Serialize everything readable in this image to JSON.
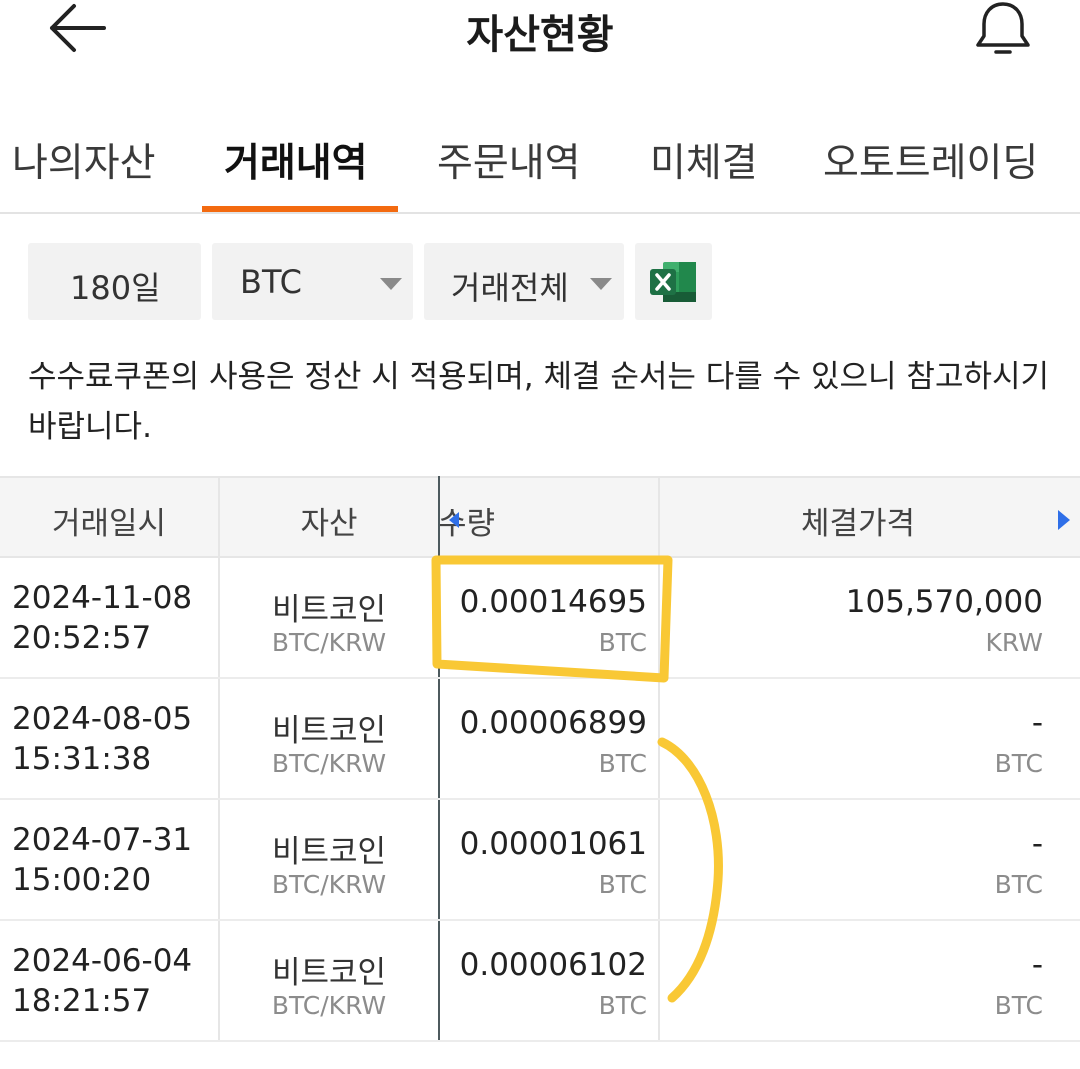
{
  "header": {
    "title": "자산현황",
    "back_icon": "arrow-left-icon",
    "bell_icon": "bell-icon"
  },
  "tabs": [
    {
      "label": "나의자산",
      "active": false
    },
    {
      "label": "거래내역",
      "active": true
    },
    {
      "label": "주문내역",
      "active": false
    },
    {
      "label": "미체결",
      "active": false
    },
    {
      "label": "오토트레이딩",
      "active": false
    }
  ],
  "filters": {
    "period": "180일",
    "asset": "BTC",
    "trade_type": "거래전체",
    "excel_icon": "excel-icon"
  },
  "notice": "수수료쿠폰의 사용은 정산 시 적용되며, 체결 순서는 다를 수 있으니 참고하시기 바랍니다.",
  "table": {
    "headers": [
      "거래일시",
      "자산",
      "수량",
      "체결가격"
    ],
    "rows": [
      {
        "date": "2024-11-08",
        "time": "20:52:57",
        "asset": "비트코인",
        "pair": "BTC/KRW",
        "qty": "0.00014695",
        "qty_unit": "BTC",
        "price": "105,570,000",
        "price_unit": "KRW"
      },
      {
        "date": "2024-08-05",
        "time": "15:31:38",
        "asset": "비트코인",
        "pair": "BTC/KRW",
        "qty": "0.00006899",
        "qty_unit": "BTC",
        "price": "-",
        "price_unit": "BTC"
      },
      {
        "date": "2024-07-31",
        "time": "15:00:20",
        "asset": "비트코인",
        "pair": "BTC/KRW",
        "qty": "0.00001061",
        "qty_unit": "BTC",
        "price": "-",
        "price_unit": "BTC"
      },
      {
        "date": "2024-06-04",
        "time": "18:21:57",
        "asset": "비트코인",
        "pair": "BTC/KRW",
        "qty": "0.00006102",
        "qty_unit": "BTC",
        "price": "-",
        "price_unit": "BTC"
      }
    ]
  },
  "colors": {
    "accent": "#f36a10",
    "highlight": "#f9c835",
    "excel_green": "#1e7145",
    "scroll_arrow": "#2f6fe8"
  }
}
